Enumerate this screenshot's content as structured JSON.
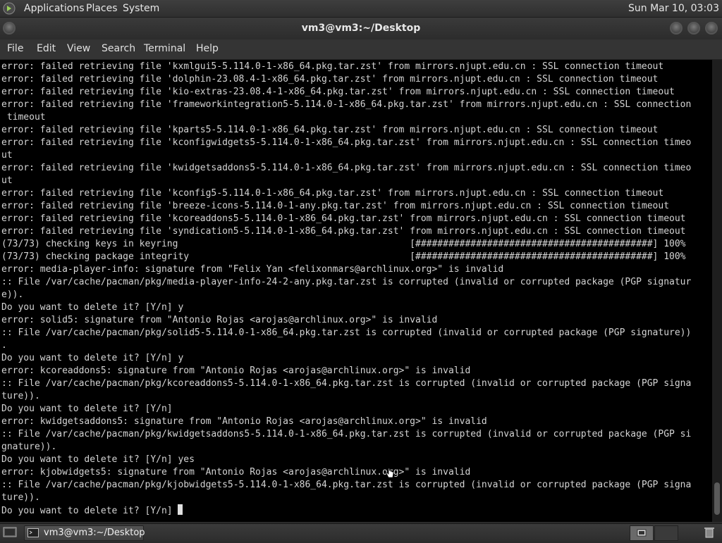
{
  "top_panel": {
    "menus": [
      "Applications",
      "Places",
      "System"
    ],
    "clock": "Sun Mar 10, 03:03"
  },
  "window": {
    "title": "vm3@vm3:~/Desktop"
  },
  "menubar": {
    "items": [
      "File",
      "Edit",
      "View",
      "Search",
      "Terminal",
      "Help"
    ]
  },
  "terminal": {
    "lines": [
      "error: failed retrieving file 'kxmlgui5-5.114.0-1-x86_64.pkg.tar.zst' from mirrors.njupt.edu.cn : SSL connection timeout",
      "error: failed retrieving file 'dolphin-23.08.4-1-x86_64.pkg.tar.zst' from mirrors.njupt.edu.cn : SSL connection timeout",
      "error: failed retrieving file 'kio-extras-23.08.4-1-x86_64.pkg.tar.zst' from mirrors.njupt.edu.cn : SSL connection timeout",
      "error: failed retrieving file 'frameworkintegration5-5.114.0-1-x86_64.pkg.tar.zst' from mirrors.njupt.edu.cn : SSL connection",
      " timeout",
      "error: failed retrieving file 'kparts5-5.114.0-1-x86_64.pkg.tar.zst' from mirrors.njupt.edu.cn : SSL connection timeout",
      "error: failed retrieving file 'kconfigwidgets5-5.114.0-1-x86_64.pkg.tar.zst' from mirrors.njupt.edu.cn : SSL connection timeo",
      "ut",
      "error: failed retrieving file 'kwidgetsaddons5-5.114.0-1-x86_64.pkg.tar.zst' from mirrors.njupt.edu.cn : SSL connection timeo",
      "ut",
      "error: failed retrieving file 'kconfig5-5.114.0-1-x86_64.pkg.tar.zst' from mirrors.njupt.edu.cn : SSL connection timeout",
      "error: failed retrieving file 'breeze-icons-5.114.0-1-any.pkg.tar.zst' from mirrors.njupt.edu.cn : SSL connection timeout",
      "error: failed retrieving file 'kcoreaddons5-5.114.0-1-x86_64.pkg.tar.zst' from mirrors.njupt.edu.cn : SSL connection timeout",
      "error: failed retrieving file 'syndication5-5.114.0-1-x86_64.pkg.tar.zst' from mirrors.njupt.edu.cn : SSL connection timeout",
      "(73/73) checking keys in keyring                                          [###########################################] 100%",
      "(73/73) checking package integrity                                        [###########################################] 100%",
      "error: media-player-info: signature from \"Felix Yan <felixonmars@archlinux.org>\" is invalid",
      ":: File /var/cache/pacman/pkg/media-player-info-24-2-any.pkg.tar.zst is corrupted (invalid or corrupted package (PGP signatur",
      "e)).",
      "Do you want to delete it? [Y/n] y",
      "error: solid5: signature from \"Antonio Rojas <arojas@archlinux.org>\" is invalid",
      ":: File /var/cache/pacman/pkg/solid5-5.114.0-1-x86_64.pkg.tar.zst is corrupted (invalid or corrupted package (PGP signature))",
      ".",
      "Do you want to delete it? [Y/n] y",
      "error: kcoreaddons5: signature from \"Antonio Rojas <arojas@archlinux.org>\" is invalid",
      ":: File /var/cache/pacman/pkg/kcoreaddons5-5.114.0-1-x86_64.pkg.tar.zst is corrupted (invalid or corrupted package (PGP signa",
      "ture)).",
      "Do you want to delete it? [Y/n]",
      "error: kwidgetsaddons5: signature from \"Antonio Rojas <arojas@archlinux.org>\" is invalid",
      ":: File /var/cache/pacman/pkg/kwidgetsaddons5-5.114.0-1-x86_64.pkg.tar.zst is corrupted (invalid or corrupted package (PGP si",
      "gnature)).",
      "Do you want to delete it? [Y/n] yes",
      "error: kjobwidgets5: signature from \"Antonio Rojas <arojas@archlinux.org>\" is invalid",
      ":: File /var/cache/pacman/pkg/kjobwidgets5-5.114.0-1-x86_64.pkg.tar.zst is corrupted (invalid or corrupted package (PGP signa",
      "ture)).",
      "Do you want to delete it? [Y/n] "
    ],
    "hovered_link": "arojas@archlinux.org"
  },
  "taskbar": {
    "task_label": "vm3@vm3:~/Desktop"
  }
}
